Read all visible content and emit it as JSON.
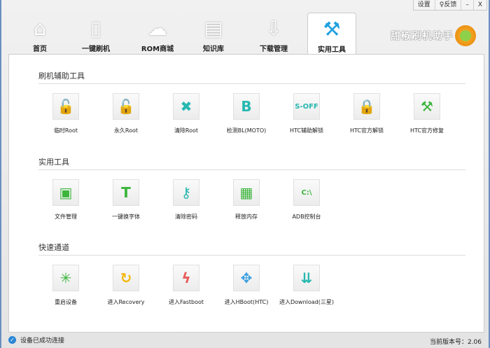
{
  "window": {
    "settings": "设置",
    "feedback": "♀反馈",
    "minimize": "–",
    "close": "X"
  },
  "tabs": [
    {
      "label": "首页",
      "icon": "home-icon",
      "glyph": "⌂"
    },
    {
      "label": "一键刷机",
      "icon": "phone-flash-icon",
      "glyph": "▯"
    },
    {
      "label": "ROM商城",
      "icon": "cloud-download-icon",
      "glyph": "☁"
    },
    {
      "label": "知识库",
      "icon": "document-icon",
      "glyph": "▤"
    },
    {
      "label": "下载管理",
      "icon": "download-icon",
      "glyph": "⇩"
    },
    {
      "label": "实用工具",
      "icon": "tools-icon",
      "glyph": "⚒",
      "active": true
    }
  ],
  "logo": "甜椒刷机助手",
  "sections": [
    {
      "title": "刷机辅助工具",
      "items": [
        {
          "label": "临时Root",
          "icon": "unlock-icon",
          "glyph": "🔓",
          "color": "#f2b90f"
        },
        {
          "label": "永久Root",
          "icon": "unlock-icon",
          "glyph": "🔓",
          "color": "#e8893a"
        },
        {
          "label": "清除Root",
          "icon": "android-clear-icon",
          "glyph": "✖",
          "color": "#27b8b0"
        },
        {
          "label": "检测BL(MOTO)",
          "icon": "b-letter-icon",
          "glyph": "B",
          "color": "#27b8b0"
        },
        {
          "label": "HTC辅助解锁",
          "icon": "s-off-icon",
          "glyph": "S-OFF",
          "color": "#27b8b0"
        },
        {
          "label": "HTC官方解锁",
          "icon": "lock-icon",
          "glyph": "🔒",
          "color": "#3cb53c"
        },
        {
          "label": "HTC官方修复",
          "icon": "hammer-icon",
          "glyph": "⚒",
          "color": "#3cb53c"
        }
      ]
    },
    {
      "title": "实用工具",
      "items": [
        {
          "label": "文件管理",
          "icon": "folder-icon",
          "glyph": "▣",
          "color": "#3cb53c"
        },
        {
          "label": "一键换字体",
          "icon": "font-icon",
          "glyph": "T",
          "color": "#3cb53c"
        },
        {
          "label": "清除密码",
          "icon": "key-icon",
          "glyph": "⚷",
          "color": "#27b8b0"
        },
        {
          "label": "释放内存",
          "icon": "memory-icon",
          "glyph": "▦",
          "color": "#3cb53c"
        },
        {
          "label": "ADB控制台",
          "icon": "console-icon",
          "glyph": "C:\\",
          "color": "#3cb53c"
        }
      ]
    },
    {
      "title": "快速通道",
      "items": [
        {
          "label": "重启设备",
          "icon": "restart-icon",
          "glyph": "✳",
          "color": "#3cb53c"
        },
        {
          "label": "进入Recovery",
          "icon": "recovery-icon",
          "glyph": "↻",
          "color": "#f2b90f"
        },
        {
          "label": "进入Fastboot",
          "icon": "fastboot-icon",
          "glyph": "ϟ",
          "color": "#e85a5a"
        },
        {
          "label": "进入HBoot(HTC)",
          "icon": "hboot-icon",
          "glyph": "✥",
          "color": "#3aa0e0"
        },
        {
          "label": "进入Download(三星)",
          "icon": "download-mode-icon",
          "glyph": "⇊",
          "color": "#27b8b0"
        }
      ]
    }
  ],
  "status": {
    "text": "设备已成功连接",
    "version": "当前版本号：2.06"
  }
}
